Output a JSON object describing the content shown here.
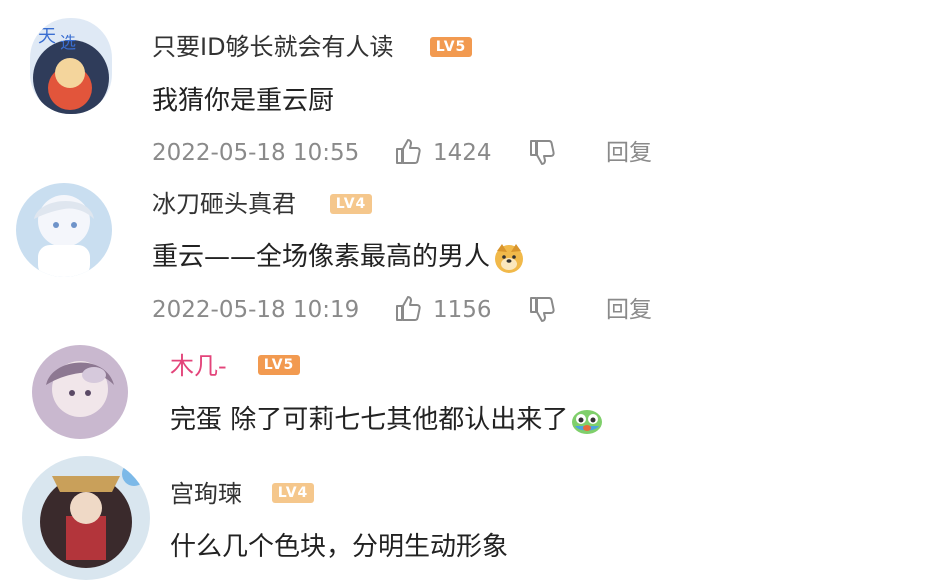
{
  "comments": [
    {
      "username": "只要ID够长就会有人读",
      "level": "LV5",
      "text": "我猜你是重云厨",
      "date": "2022-05-18 10:55",
      "likes": "1424",
      "reply": "回复",
      "avatar_icon": "avatar-image",
      "like_icon": "thumbs-up-icon",
      "dislike_icon": "thumbs-down-icon"
    },
    {
      "username": "冰刀砸头真君",
      "level": "LV4",
      "text": "重云——全场像素最高的男人",
      "emoji": "doge-emoji",
      "date": "2022-05-18 10:19",
      "likes": "1156",
      "reply": "回复"
    },
    {
      "username": "木几-",
      "level": "LV5",
      "text": "完蛋 除了可莉七七其他都认出来了",
      "emoji": "crying-emoji"
    },
    {
      "username": "宫珣瑓",
      "level": "LV4",
      "text": "什么几个色块，分明生动形象"
    }
  ],
  "colors": {
    "username": "#333333",
    "username_vip": "#e3447a",
    "meta": "#8a8a8a",
    "lv5": "#f29a50",
    "lv4": "#f5c78c"
  }
}
